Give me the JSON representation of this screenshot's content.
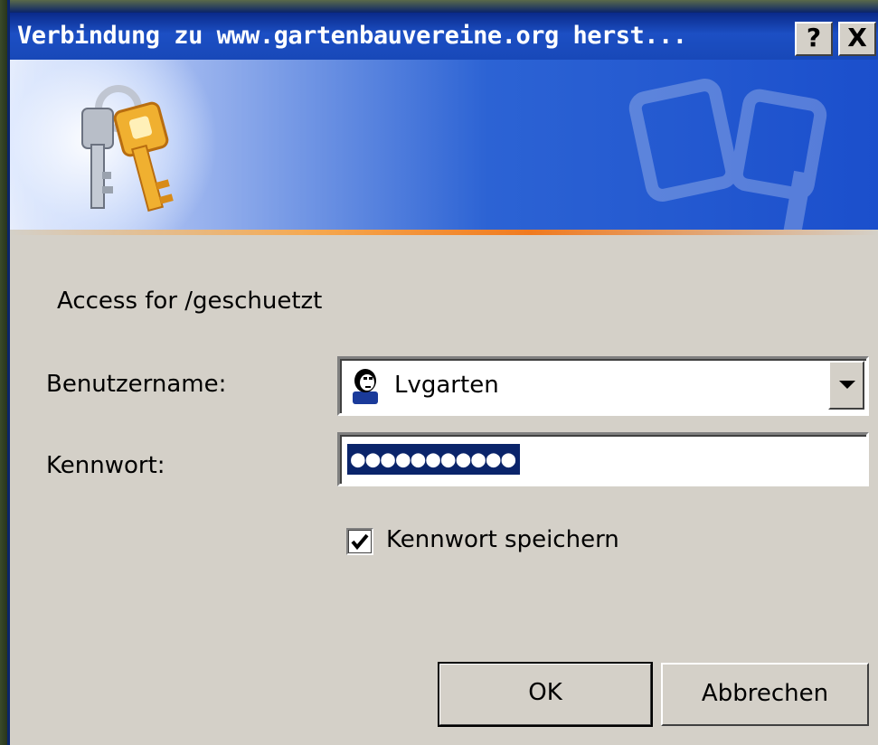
{
  "window": {
    "title": "Verbindung zu www.gartenbauvereine.org herst...",
    "help_label": "?",
    "close_label": "X"
  },
  "banner": {
    "icon": "keys-icon",
    "colors": {
      "accent_line": "#f07a20",
      "banner_blue": "#1b4fcc"
    }
  },
  "form": {
    "realm_text": "Access for /geschuetzt",
    "username_label": "Benutzername:",
    "username_value": "Lvgarten",
    "username_icon": "user-icon",
    "password_label": "Kennwort:",
    "password_value": "●●●●●●●●●●●",
    "remember_label": "Kennwort speichern",
    "remember_checked": true
  },
  "buttons": {
    "ok": "OK",
    "cancel": "Abbrechen"
  }
}
